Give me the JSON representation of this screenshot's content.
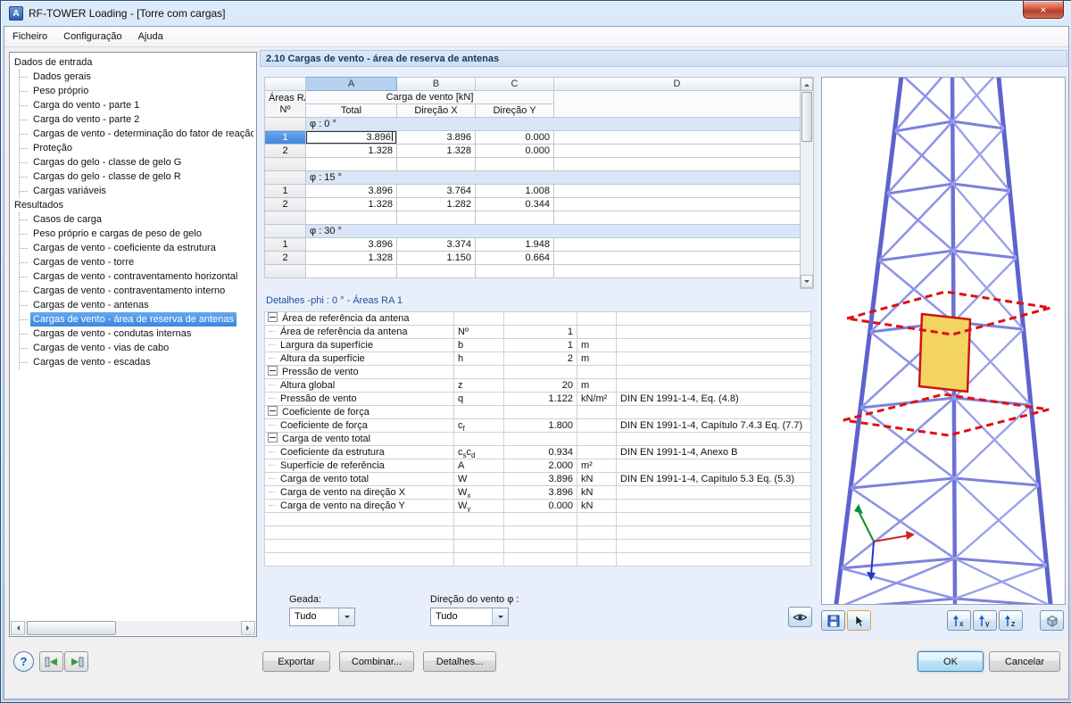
{
  "window": {
    "title": "RF-TOWER Loading - [Torre com cargas]"
  },
  "icons": {
    "app": "A",
    "close": "×",
    "help": "?"
  },
  "menu": {
    "items": [
      "Ficheiro",
      "Configuração",
      "Ajuda"
    ]
  },
  "sidebar": {
    "sections": [
      {
        "label": "Dados de entrada",
        "items": [
          {
            "label": "Dados gerais"
          },
          {
            "label": "Peso próprio"
          },
          {
            "label": "Carga do vento - parte 1"
          },
          {
            "label": "Carga do vento - parte 2"
          },
          {
            "label": "Cargas de vento - determinação do fator de reação"
          },
          {
            "label": "Proteção"
          },
          {
            "label": "Cargas do gelo - classe de gelo G"
          },
          {
            "label": "Cargas do gelo - classe de gelo R"
          },
          {
            "label": "Cargas variáveis"
          }
        ]
      },
      {
        "label": "Resultados",
        "items": [
          {
            "label": "Casos de carga"
          },
          {
            "label": "Peso próprio e cargas de peso de gelo"
          },
          {
            "label": "Cargas de vento - coeficiente da estrutura"
          },
          {
            "label": "Cargas de vento - torre"
          },
          {
            "label": "Cargas de vento - contraventamento horizontal"
          },
          {
            "label": "Cargas de vento - contraventamento interno"
          },
          {
            "label": "Cargas de vento - antenas"
          },
          {
            "label": "Cargas de vento - área de reserva de antenas",
            "selected": true
          },
          {
            "label": "Cargas de vento - condutas internas"
          },
          {
            "label": "Cargas de vento - vias de cabo"
          },
          {
            "label": "Cargas de vento - escadas"
          }
        ]
      }
    ]
  },
  "main": {
    "title": "2.10 Cargas de vento - área de reserva de antenas",
    "table": {
      "column_letters": [
        "A",
        "B",
        "C",
        "D"
      ],
      "active_column": "A",
      "corner_line1": "Áreas RA",
      "corner_line2": "Nº",
      "group_header": "Carga de vento [kN]",
      "subheaders": [
        "Total",
        "Direção X",
        "Direção Y"
      ],
      "groups": [
        {
          "phi": "φ : 0 °",
          "rows": [
            {
              "num": "1",
              "total": "3.896",
              "dir_x": "3.896",
              "dir_y": "0.000",
              "selected": true,
              "editing": true
            },
            {
              "num": "2",
              "total": "1.328",
              "dir_x": "1.328",
              "dir_y": "0.000"
            }
          ]
        },
        {
          "phi": "φ : 15 °",
          "rows": [
            {
              "num": "1",
              "total": "3.896",
              "dir_x": "3.764",
              "dir_y": "1.008"
            },
            {
              "num": "2",
              "total": "1.328",
              "dir_x": "1.282",
              "dir_y": "0.344"
            }
          ]
        },
        {
          "phi": "φ : 30 °",
          "rows": [
            {
              "num": "1",
              "total": "3.896",
              "dir_x": "3.374",
              "dir_y": "1.948"
            },
            {
              "num": "2",
              "total": "1.328",
              "dir_x": "1.150",
              "dir_y": "0.664"
            }
          ]
        }
      ]
    },
    "details": {
      "title": "Detalhes  -phi : 0 ° - Áreas RA 1",
      "groups": [
        {
          "label": "Área de referência da antena",
          "rows": [
            {
              "label": "Área de referência da antena",
              "sym": "Nº",
              "value": "1",
              "unit": "",
              "note": ""
            },
            {
              "label": "Largura da superfície",
              "sym": "b",
              "value": "1",
              "unit": "m",
              "note": ""
            },
            {
              "label": "Altura da superfície",
              "sym": "h",
              "value": "2",
              "unit": "m",
              "note": ""
            }
          ]
        },
        {
          "label": "Pressão de vento",
          "rows": [
            {
              "label": "Altura global",
              "sym": "z",
              "value": "20",
              "unit": "m",
              "note": ""
            },
            {
              "label": "Pressão de vento",
              "sym": "q",
              "value": "1.122",
              "unit": "kN/m²",
              "note": "DIN EN 1991-1-4, Eq. (4.8)"
            }
          ]
        },
        {
          "label": "Coeficiente de força",
          "rows": [
            {
              "label": "Coeficiente de força",
              "sym": "c{f}",
              "value": "1.800",
              "unit": "",
              "note": "DIN EN 1991-1-4, Capítulo 7.4.3 Eq. (7.7)"
            }
          ]
        },
        {
          "label": "Carga de vento total",
          "rows": [
            {
              "label": "Coeficiente da estrutura",
              "sym": "c{s}c{d}",
              "value": "0.934",
              "unit": "",
              "note": "DIN EN 1991-1-4, Anexo B"
            },
            {
              "label": "Superfície de referência",
              "sym": "A",
              "value": "2.000",
              "unit": "m²",
              "note": ""
            },
            {
              "label": "Carga de vento total",
              "sym": "W",
              "value": "3.896",
              "unit": "kN",
              "note": "DIN EN 1991-1-4, Capítulo 5.3 Eq. (5.3)"
            },
            {
              "label": "Carga de vento na direção X",
              "sym": "W{x}",
              "value": "3.896",
              "unit": "kN",
              "note": ""
            },
            {
              "label": "Carga de vento na direção Y",
              "sym": "W{y}",
              "value": "0.000",
              "unit": "kN",
              "note": ""
            }
          ]
        }
      ],
      "empty_rows": 4
    },
    "controls": {
      "geada_label": "Geada:",
      "geada_value": "Tudo",
      "wind_label": "Direção do vento φ :",
      "wind_value": "Tudo"
    }
  },
  "footer": {
    "export": "Exportar",
    "combine": "Combinar...",
    "details": "Detalhes...",
    "ok": "OK",
    "cancel": "Cancelar"
  }
}
